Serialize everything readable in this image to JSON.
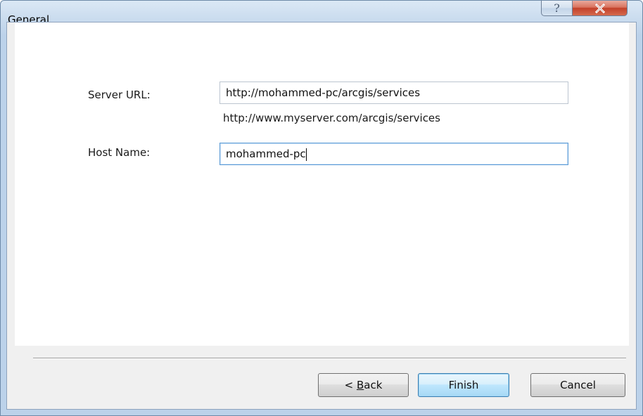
{
  "window": {
    "title": "General",
    "help_glyph": "?",
    "help_icon": "help-icon",
    "close_icon": "close-icon"
  },
  "form": {
    "server_url_label": "Server URL:",
    "server_url_value": "http://mohammed-pc/arcgis/services",
    "server_url_hint": "http://www.myserver.com/arcgis/services",
    "host_name_label": "Host Name:",
    "host_name_value": "mohammed-pc"
  },
  "buttons": {
    "back_prefix": "< ",
    "back_mnemonic": "B",
    "back_rest": "ack",
    "finish": "Finish",
    "cancel": "Cancel"
  },
  "colors": {
    "close_button": "#c2412a",
    "focused_border": "#5b9bd5",
    "default_button": "#bee6fd"
  }
}
